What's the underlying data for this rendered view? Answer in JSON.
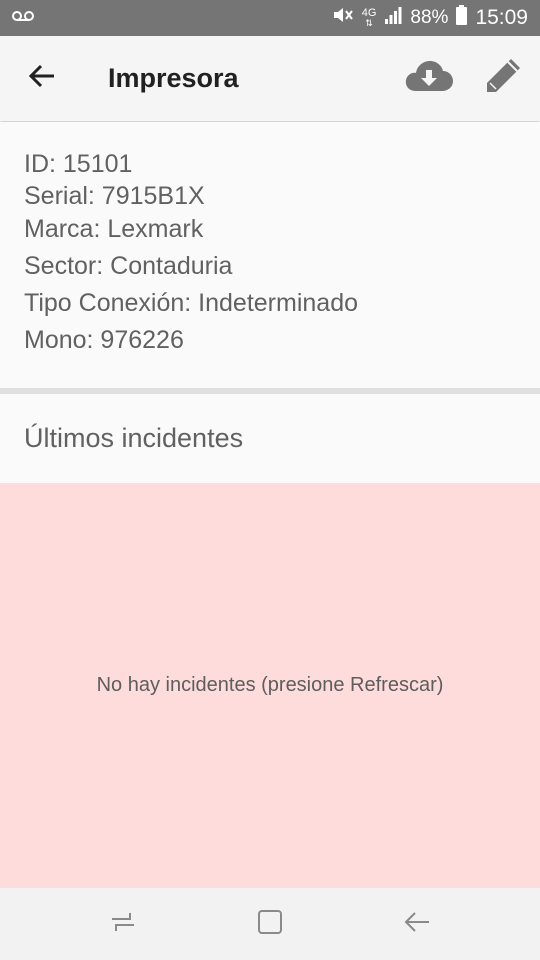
{
  "status_bar": {
    "network": "4G",
    "battery_percent": "88%",
    "time": "15:09",
    "icons": [
      "voicemail-icon",
      "mute-icon",
      "network-4g-icon",
      "signal-icon",
      "battery-icon"
    ]
  },
  "app_bar": {
    "title": "Impresora",
    "back_icon": "arrow-back-icon",
    "actions": [
      "cloud-download-icon",
      "edit-pencil-icon"
    ]
  },
  "details": {
    "id": "ID: 15101",
    "serial": "Serial: 7915B1X",
    "marca": "Marca: Lexmark",
    "sector": "Sector: Contaduria",
    "tipo_conexion": "Tipo Conexión: Indeterminado",
    "mono": "Mono: 976226"
  },
  "incidents": {
    "title": "Últimos incidentes",
    "empty_message": "No hay incidentes (presione Refrescar)",
    "panel_color": "#ffdcdc"
  },
  "nav_bar": {
    "icons": [
      "recents-icon",
      "home-icon",
      "back-icon"
    ]
  }
}
